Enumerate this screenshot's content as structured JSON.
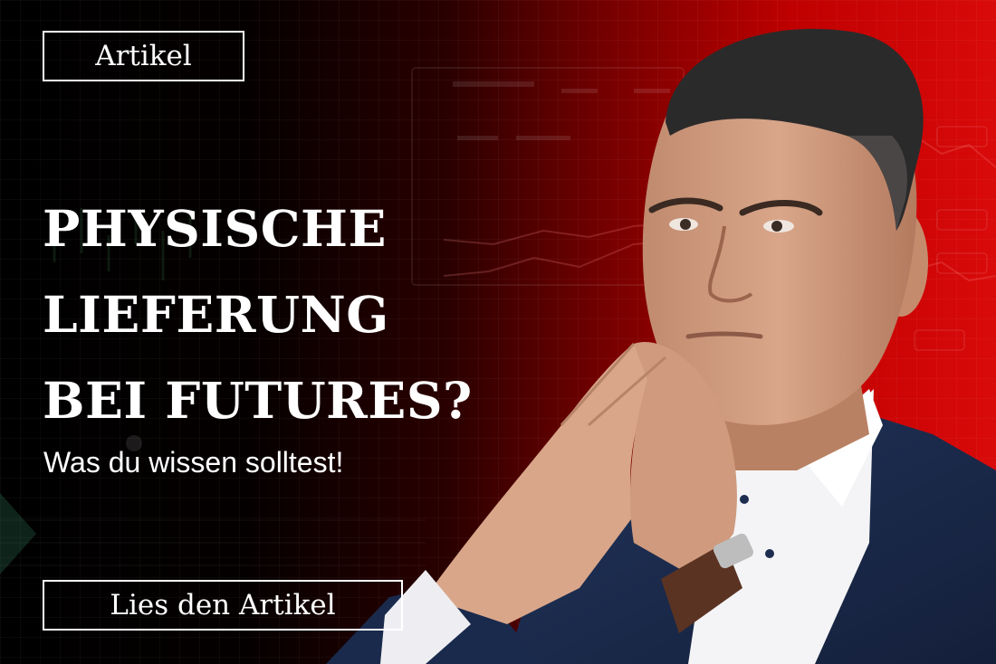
{
  "tag": {
    "label": "Artikel"
  },
  "headline": {
    "lines": [
      "PHYSISCHE",
      "LIEFERUNG",
      "BEI FUTURES?"
    ]
  },
  "subline": "Was du wissen solltest!",
  "cta": {
    "label": "Lies den Artikel"
  },
  "colors": {
    "background_left": "#000000",
    "background_right": "#d90a0a",
    "text": "#ffffff",
    "suit": "#1d2d4f"
  }
}
